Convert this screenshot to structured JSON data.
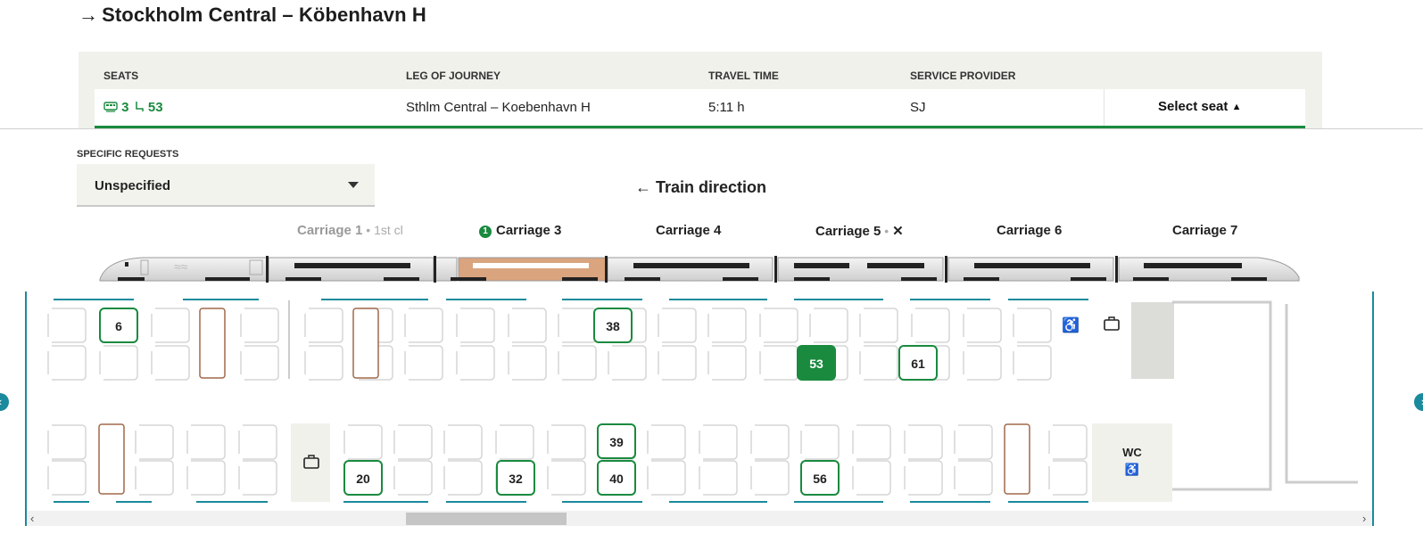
{
  "journey_title": "Stockholm Central – Köbenhavn H",
  "table": {
    "headers": {
      "seats": "SEATS",
      "leg": "LEG OF JOURNEY",
      "time": "TRAVEL TIME",
      "provider": "SERVICE PROVIDER"
    },
    "row": {
      "carriage": "3",
      "seat": "53",
      "leg": "Sthlm Central – Koebenhavn H",
      "time": "5:11 h",
      "provider": "SJ",
      "select_label": "Select seat"
    }
  },
  "requests": {
    "label": "SPECIFIC REQUESTS",
    "value": "Unspecified"
  },
  "train_direction": "Train direction",
  "carriages": [
    {
      "label": "Carriage 1",
      "sub": "1st cl"
    },
    {
      "label": "Carriage 3",
      "badge": "1"
    },
    {
      "label": "Carriage 4"
    },
    {
      "label": "Carriage 5"
    },
    {
      "label": "Carriage 6"
    },
    {
      "label": "Carriage 7"
    }
  ],
  "seats": {
    "available": [
      "6",
      "38",
      "61",
      "39",
      "20",
      "32",
      "40",
      "56"
    ],
    "selected": "53"
  },
  "wc_label": "WC",
  "colors": {
    "green": "#1a8a3f",
    "teal": "#1a8a9c",
    "selected_carriage": "#d9a47e",
    "table_bg": "#f1f1ec"
  }
}
